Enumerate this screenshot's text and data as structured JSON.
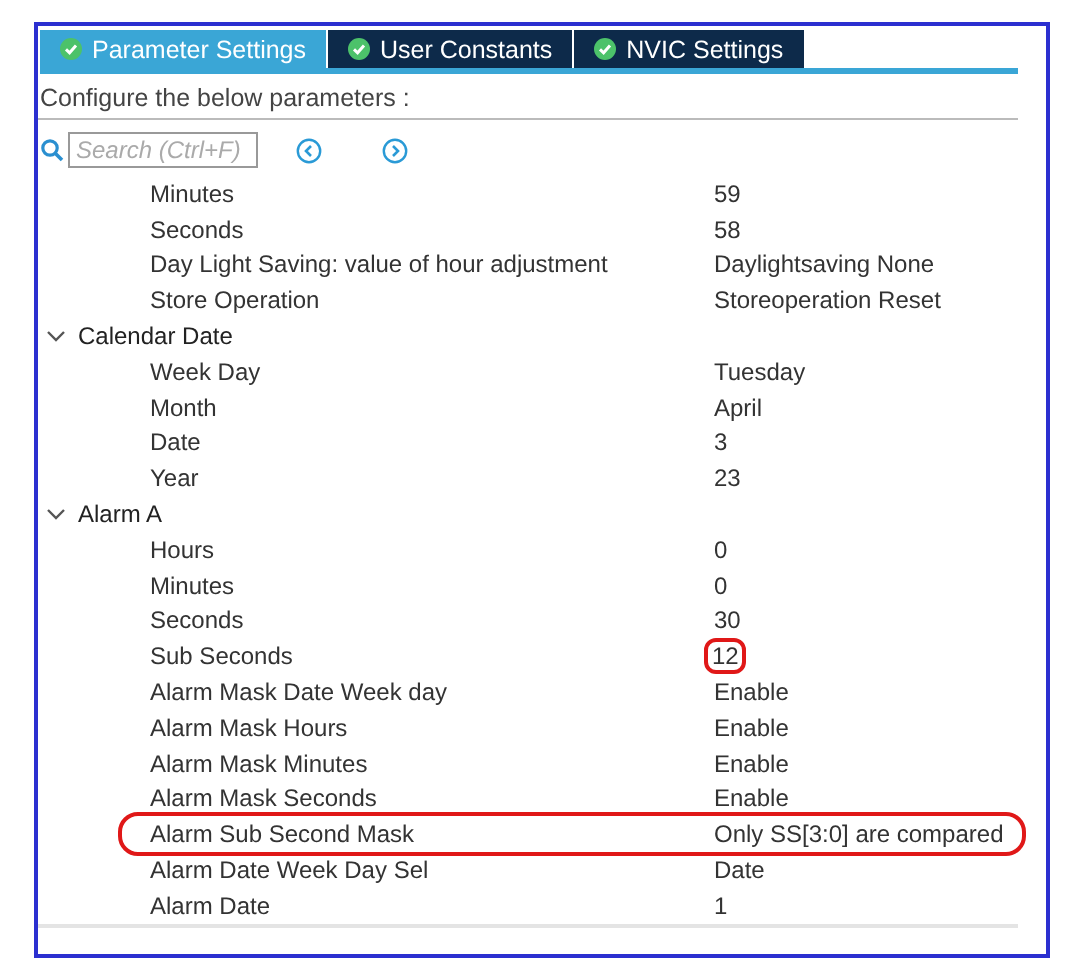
{
  "tabs": [
    {
      "label": "Parameter Settings",
      "selected": true
    },
    {
      "label": "User Constants",
      "selected": false
    },
    {
      "label": "NVIC Settings",
      "selected": false
    }
  ],
  "instructions": "Configure the below parameters :",
  "search": {
    "placeholder": "Search (Ctrl+F)"
  },
  "items": [
    {
      "kind": "param",
      "label": "Minutes",
      "value": "59"
    },
    {
      "kind": "param",
      "label": "Seconds",
      "value": "58"
    },
    {
      "kind": "param",
      "label": "Day Light Saving: value of hour adjustment",
      "value": "Daylightsaving None"
    },
    {
      "kind": "param",
      "label": "Store Operation",
      "value": "Storeoperation Reset"
    },
    {
      "kind": "group",
      "label": "Calendar Date",
      "expanded": true,
      "children": [
        {
          "kind": "param",
          "label": "Week Day",
          "value": "Tuesday"
        },
        {
          "kind": "param",
          "label": "Month",
          "value": "April"
        },
        {
          "kind": "param",
          "label": "Date",
          "value": "3"
        },
        {
          "kind": "param",
          "label": "Year",
          "value": "23"
        }
      ]
    },
    {
      "kind": "group",
      "label": "Alarm A",
      "expanded": true,
      "children": [
        {
          "kind": "param",
          "label": "Hours",
          "value": "0"
        },
        {
          "kind": "param",
          "label": "Minutes",
          "value": "0"
        },
        {
          "kind": "param",
          "label": "Seconds",
          "value": "30"
        },
        {
          "kind": "ringed-value",
          "label": "Sub Seconds",
          "value": "12"
        },
        {
          "kind": "param",
          "label": "Alarm Mask Date Week day",
          "value": "Enable"
        },
        {
          "kind": "param",
          "label": "Alarm Mask Hours",
          "value": "Enable"
        },
        {
          "kind": "param",
          "label": "Alarm Mask Minutes",
          "value": "Enable"
        },
        {
          "kind": "param",
          "label": "Alarm Mask Seconds",
          "value": "Enable"
        },
        {
          "kind": "ringed-row",
          "label": "Alarm Sub Second Mask",
          "value": "Only SS[3:0] are compared"
        },
        {
          "kind": "param",
          "label": "Alarm Date Week Day Sel",
          "value": "Date"
        },
        {
          "kind": "param",
          "label": "Alarm Date",
          "value": "1"
        }
      ]
    }
  ]
}
